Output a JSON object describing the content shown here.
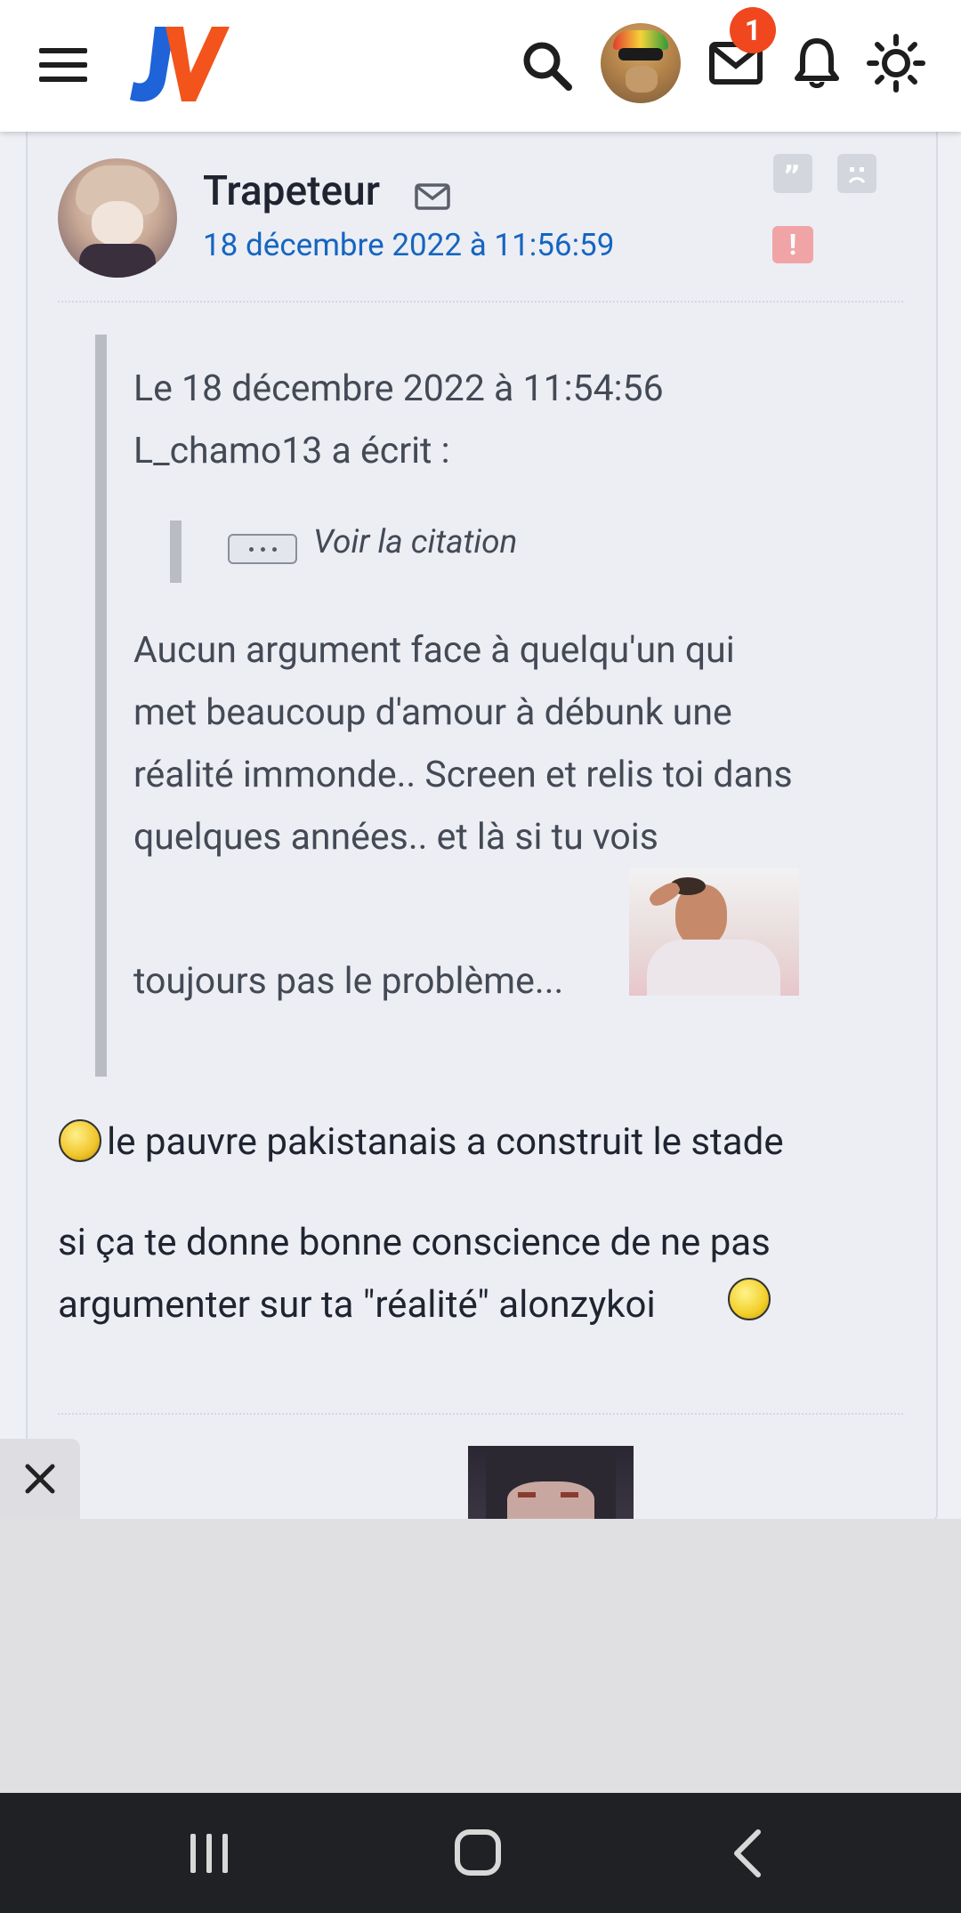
{
  "header": {
    "logo_text": "JV",
    "notification_count": "1"
  },
  "post": {
    "author": "Trapeteur",
    "date": "18 décembre 2022 à 11:56:59",
    "quote": {
      "header_line1": "Le 18 décembre 2022 à 11:54:56",
      "header_line2": "L_chamo13 a écrit :",
      "nested_label": "Voir la citation",
      "body_line1": "Aucun argument face à quelqu'un qui",
      "body_line2": "met beaucoup d'amour à débunk une",
      "body_line3": "réalité immonde.. Screen et relis toi dans",
      "body_line4": "quelques années.. et là si tu vois",
      "body_line5": "toujours pas le problème..."
    },
    "reply_line1": "le pauvre pakistanais a construit le stade",
    "reply_line2": "si ça te donne bonne conscience de ne pas",
    "reply_line3": "argumenter sur ta \"réalité\" alonzykoi"
  },
  "colors": {
    "accent_link": "#1565c0",
    "badge": "#f0471f",
    "alert": "#f1a4a5",
    "logo_blue": "#1e63d8",
    "logo_orange": "#f2541b"
  },
  "icons": [
    "menu-icon",
    "search-icon",
    "mail-icon",
    "bell-icon",
    "brightness-icon",
    "quote-icon",
    "sad-face-icon",
    "alert-icon",
    "close-icon"
  ]
}
